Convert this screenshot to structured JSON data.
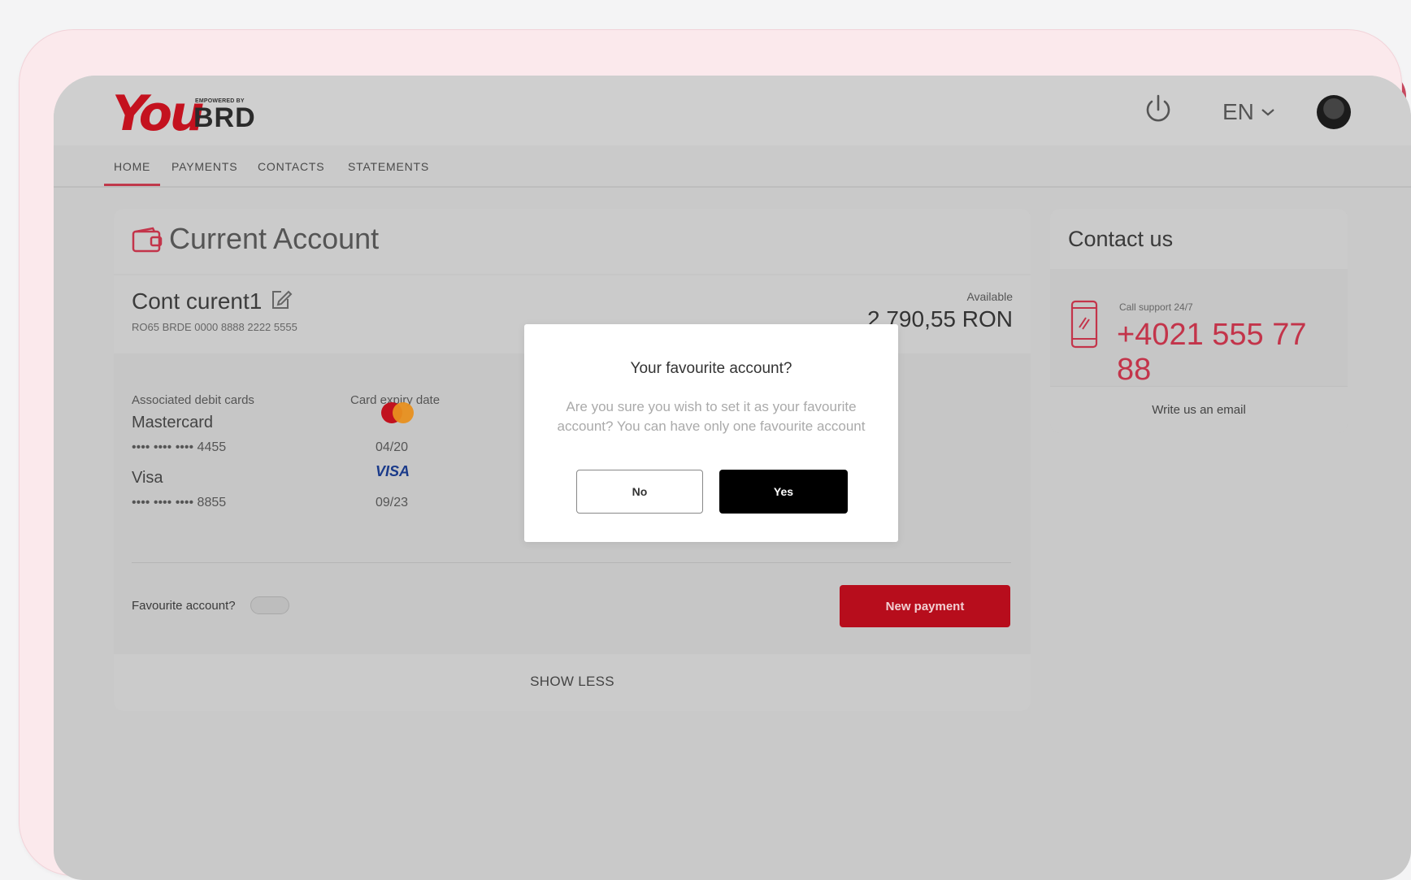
{
  "brand": {
    "logo_you": "You",
    "logo_small": "EMPOWERED BY",
    "logo_brd": "BRD"
  },
  "header": {
    "language": "EN"
  },
  "nav": [
    {
      "label": "HOME",
      "active": true
    },
    {
      "label": "PAYMENTS",
      "active": false
    },
    {
      "label": "CONTACTS",
      "active": false
    },
    {
      "label": "STATEMENTS",
      "active": false
    }
  ],
  "account_card": {
    "title": "Current Account",
    "account_name": "Cont curent1",
    "iban": "RO65 BRDE 0000 8888 2222 5555",
    "available_label": "Available",
    "available_amount": "2 790,55 RON",
    "cards_header": "Associated debit cards",
    "expiry_header": "Card expiry date",
    "cards": [
      {
        "name": "Mastercard",
        "number": "•••• •••• •••• 4455",
        "expiry": "04/20",
        "brand_icon": "mastercard-icon"
      },
      {
        "name": "Visa",
        "number": "•••• •••• ••••  8855",
        "expiry": "09/23",
        "brand_icon": "visa-icon",
        "brand_text": "VISA"
      }
    ],
    "favourite_label": "Favourite account?",
    "favourite_on": false,
    "new_payment_label": "New payment",
    "show_less_label": "SHOW LESS"
  },
  "contact": {
    "title": "Contact us",
    "call_label": "Call support 24/7",
    "phone": "+4021 555 77 88",
    "email_link": "Write us an email"
  },
  "modal": {
    "title": "Your favourite account?",
    "text": "Are you sure you wish to set it as your favourite account? You can have only one favourite account",
    "no_label": "No",
    "yes_label": "Yes"
  },
  "colors": {
    "brand_red": "#c4121f",
    "accent_pink": "#c3344a",
    "yes_button": "#000000"
  }
}
